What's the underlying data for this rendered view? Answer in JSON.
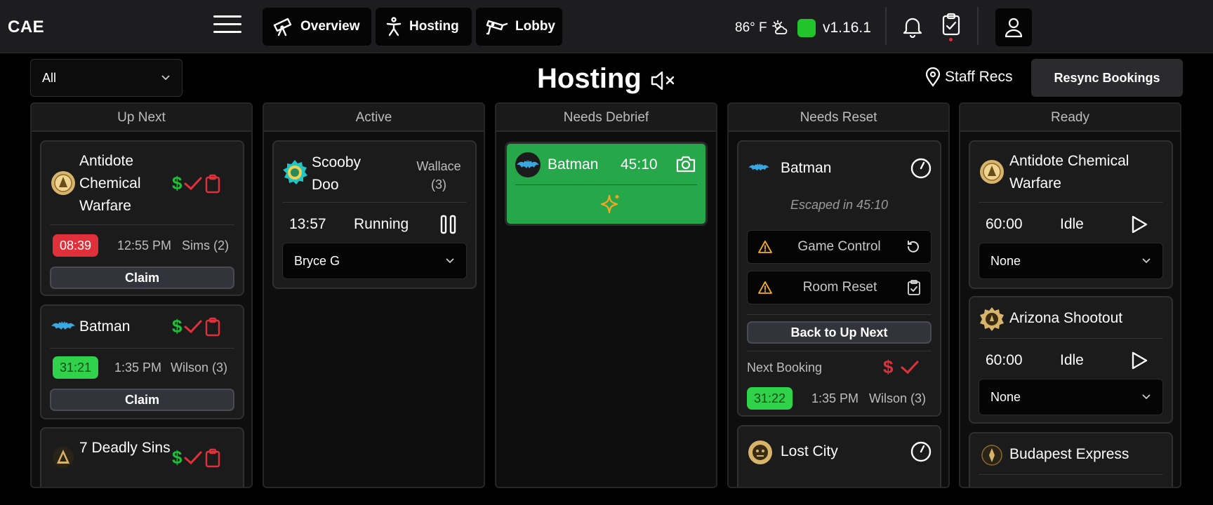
{
  "app": {
    "brand": "CAE"
  },
  "nav": {
    "overview": "Overview",
    "hosting": "Hosting",
    "lobby": "Lobby"
  },
  "status": {
    "weather": "86° F",
    "version": "v1.16.1",
    "online_color": "#21c42b"
  },
  "toolbar": {
    "filter_value": "All",
    "title": "Hosting",
    "staff_recs": "Staff Recs",
    "resync": "Resync Bookings"
  },
  "columns": {
    "up_next": {
      "header": "Up Next",
      "cards": [
        {
          "title": "Antidote Chemical Warfare",
          "timer": "08:39",
          "time": "12:55 PM",
          "host": "Sims (2)",
          "claim": "Claim"
        },
        {
          "title": "Batman",
          "timer": "31:21",
          "time": "1:35 PM",
          "host": "Wilson (3)",
          "claim": "Claim"
        },
        {
          "title": "7 Deadly Sins"
        }
      ]
    },
    "active": {
      "header": "Active",
      "card": {
        "title": "Scooby Doo",
        "host": "Wallace (3)",
        "time": "13:57",
        "state": "Running",
        "staff": "Bryce G"
      }
    },
    "needs_debrief": {
      "header": "Needs Debrief",
      "card": {
        "title": "Batman",
        "time": "45:10"
      }
    },
    "needs_reset": {
      "header": "Needs Reset",
      "card": {
        "title": "Batman",
        "escaped": "Escaped in 45:10",
        "game_control": "Game Control",
        "room_reset": "Room Reset",
        "back": "Back to Up Next",
        "next_booking_label": "Next Booking",
        "next_timer": "31:22",
        "next_time": "1:35 PM",
        "next_host": "Wilson (3)"
      },
      "card2": {
        "title": "Lost City"
      }
    },
    "ready": {
      "header": "Ready",
      "cards": [
        {
          "title": "Antidote Chemical Warfare",
          "time": "60:00",
          "state": "Idle",
          "staff": "None"
        },
        {
          "title": "Arizona Shootout",
          "time": "60:00",
          "state": "Idle",
          "staff": "None"
        },
        {
          "title": "Budapest Express"
        }
      ]
    }
  },
  "money_symbol": "$"
}
